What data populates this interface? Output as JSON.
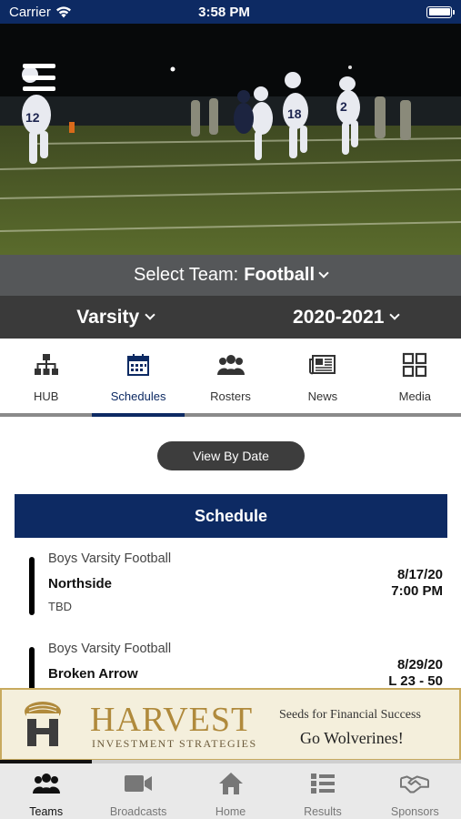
{
  "status_bar": {
    "carrier": "Carrier",
    "time": "3:58 PM",
    "battery_level": 1.0
  },
  "hero": {
    "image_description_icon": "football-game-photo",
    "menu_icon": "hamburger-menu-icon"
  },
  "team_selector": {
    "prefix": "Select Team:",
    "team": "Football",
    "level": "Varsity",
    "season": "2020-2021"
  },
  "tabs": [
    {
      "label": "HUB",
      "icon": "hierarchy-icon",
      "active": false
    },
    {
      "label": "Schedules",
      "icon": "calendar-icon",
      "active": true
    },
    {
      "label": "Rosters",
      "icon": "people-icon",
      "active": false
    },
    {
      "label": "News",
      "icon": "newspaper-icon",
      "active": false
    },
    {
      "label": "Media",
      "icon": "grid-icon",
      "active": false
    }
  ],
  "view_button": "View By Date",
  "schedule": {
    "title": "Schedule",
    "items": [
      {
        "sport": "Boys Varsity Football",
        "opponent": "Northside",
        "location": "TBD",
        "date": "8/17/20",
        "time": "7:00 PM"
      },
      {
        "sport": "Boys Varsity Football",
        "opponent": "Broken Arrow",
        "location": "",
        "date": "8/29/20",
        "time": "L 23 - 50"
      }
    ]
  },
  "ad": {
    "brand": "HARVEST",
    "sub": "INVESTMENT STRATEGIES",
    "tagline": "Seeds for Financial Success",
    "slogan": "Go Wolverines!",
    "progress": 0.2
  },
  "bottom_nav": [
    {
      "label": "Teams",
      "icon": "team-icon",
      "active": true
    },
    {
      "label": "Broadcasts",
      "icon": "video-camera-icon",
      "active": false
    },
    {
      "label": "Home",
      "icon": "home-icon",
      "active": false
    },
    {
      "label": "Results",
      "icon": "list-icon",
      "active": false
    },
    {
      "label": "Sponsors",
      "icon": "handshake-icon",
      "active": false
    }
  ],
  "colors": {
    "brand_navy": "#0d2a63",
    "team_bar": "#555759",
    "level_bar": "#3a3a3a",
    "ad_gold": "#b08a3c"
  }
}
